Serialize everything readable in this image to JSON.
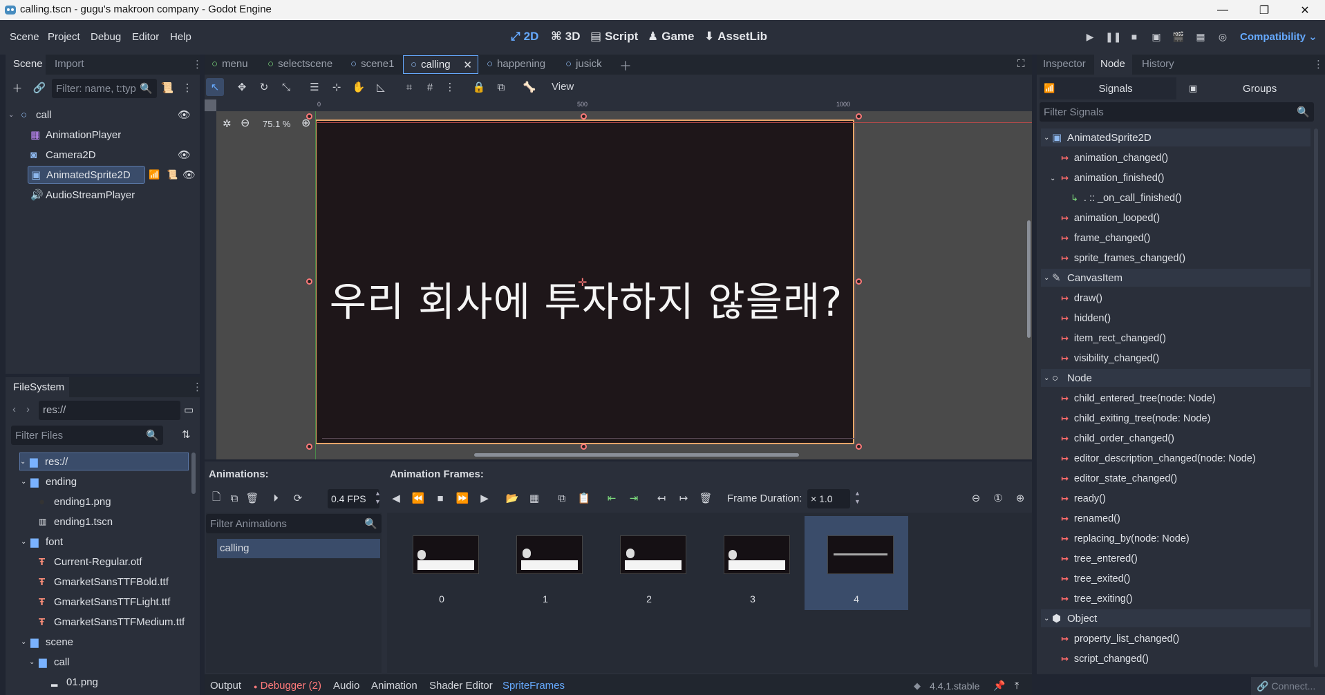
{
  "window": {
    "title": "calling.tscn - gugu's makroon company - Godot Engine"
  },
  "menus": [
    "Scene",
    "Project",
    "Debug",
    "Editor",
    "Help"
  ],
  "workspaces": [
    {
      "label": "2D",
      "icon": "2d-icon",
      "active": true
    },
    {
      "label": "3D",
      "icon": "3d-icon"
    },
    {
      "label": "Script",
      "icon": "script-icon"
    },
    {
      "label": "Game",
      "icon": "game-icon"
    },
    {
      "label": "AssetLib",
      "icon": "assetlib-icon"
    }
  ],
  "renderer": "Compatibility",
  "scene_dock": {
    "tabs": [
      "Scene",
      "Import"
    ],
    "filter_placeholder": "Filter: name, t:typ",
    "nodes": [
      {
        "name": "call",
        "icon": "node-circle-icon"
      },
      {
        "name": "AnimationPlayer",
        "icon": "animation-player-icon"
      },
      {
        "name": "Camera2D",
        "icon": "camera2d-icon"
      },
      {
        "name": "AnimatedSprite2D",
        "icon": "animated-sprite-icon"
      },
      {
        "name": "AudioStreamPlayer",
        "icon": "audio-icon"
      }
    ]
  },
  "filesystem": {
    "tab": "FileSystem",
    "path": "res://",
    "filter_placeholder": "Filter Files",
    "items": [
      {
        "name": "res://",
        "type": "folder"
      },
      {
        "name": "ending",
        "type": "folder"
      },
      {
        "name": "ending1.png",
        "type": "image"
      },
      {
        "name": "ending1.tscn",
        "type": "scene"
      },
      {
        "name": "font",
        "type": "folder"
      },
      {
        "name": "Current-Regular.otf",
        "type": "font"
      },
      {
        "name": "GmarketSansTTFBold.ttf",
        "type": "font"
      },
      {
        "name": "GmarketSansTTFLight.ttf",
        "type": "font"
      },
      {
        "name": "GmarketSansTTFMedium.ttf",
        "type": "font"
      },
      {
        "name": "scene",
        "type": "folder"
      },
      {
        "name": "call",
        "type": "folder"
      },
      {
        "name": "01.png",
        "type": "image"
      }
    ]
  },
  "scene_tabs": [
    "menu",
    "selectscene",
    "scene1",
    "calling",
    "happening",
    "jusick"
  ],
  "active_scene_tab": "calling",
  "viewport": {
    "view_label": "View",
    "zoom": "75.1 %",
    "ruler_marks": [
      "0",
      "500",
      "1000"
    ],
    "canvas_text": "우리 회사에 투자하지 않을래?"
  },
  "sprite_frames": {
    "animations_label": "Animations:",
    "frames_label": "Animation Frames:",
    "fps": "0.4 FPS",
    "filter_placeholder": "Filter Animations",
    "animations": [
      "calling"
    ],
    "frame_duration_label": "Frame Duration:",
    "frame_duration": "× 1.0",
    "frames": [
      "0",
      "1",
      "2",
      "3",
      "4"
    ],
    "selected_frame": "4"
  },
  "bottom_tabs": [
    "Output",
    "Debugger (2)",
    "Audio",
    "Animation",
    "Shader Editor",
    "SpriteFrames"
  ],
  "version": "4.4.1.stable",
  "right_dock": {
    "tabs": [
      "Inspector",
      "Node",
      "History"
    ],
    "subtabs": [
      "Signals",
      "Groups"
    ],
    "filter_placeholder": "Filter Signals",
    "groups": [
      {
        "class": "AnimatedSprite2D",
        "signals": [
          "animation_changed()",
          "animation_finished()",
          "animation_looped()",
          "frame_changed()",
          "sprite_frames_changed()"
        ]
      },
      {
        "class": "CanvasItem",
        "signals": [
          "draw()",
          "hidden()",
          "item_rect_changed()",
          "visibility_changed()"
        ]
      },
      {
        "class": "Node",
        "signals": [
          "child_entered_tree(node: Node)",
          "child_exiting_tree(node: Node)",
          "child_order_changed()",
          "editor_description_changed(node: Node)",
          "editor_state_changed()",
          "ready()",
          "renamed()",
          "replacing_by(node: Node)",
          "tree_entered()",
          "tree_exited()",
          "tree_exiting()"
        ]
      },
      {
        "class": "Object",
        "signals": [
          "property_list_changed()",
          "script_changed()"
        ]
      }
    ],
    "connection": ". :: _on_call_finished()",
    "connect_button": "Connect..."
  },
  "colors": {
    "accent": "#66aaff",
    "signal": "#ff6b6b",
    "selection": "#3a4c6a",
    "canvas": "#1e1619"
  }
}
